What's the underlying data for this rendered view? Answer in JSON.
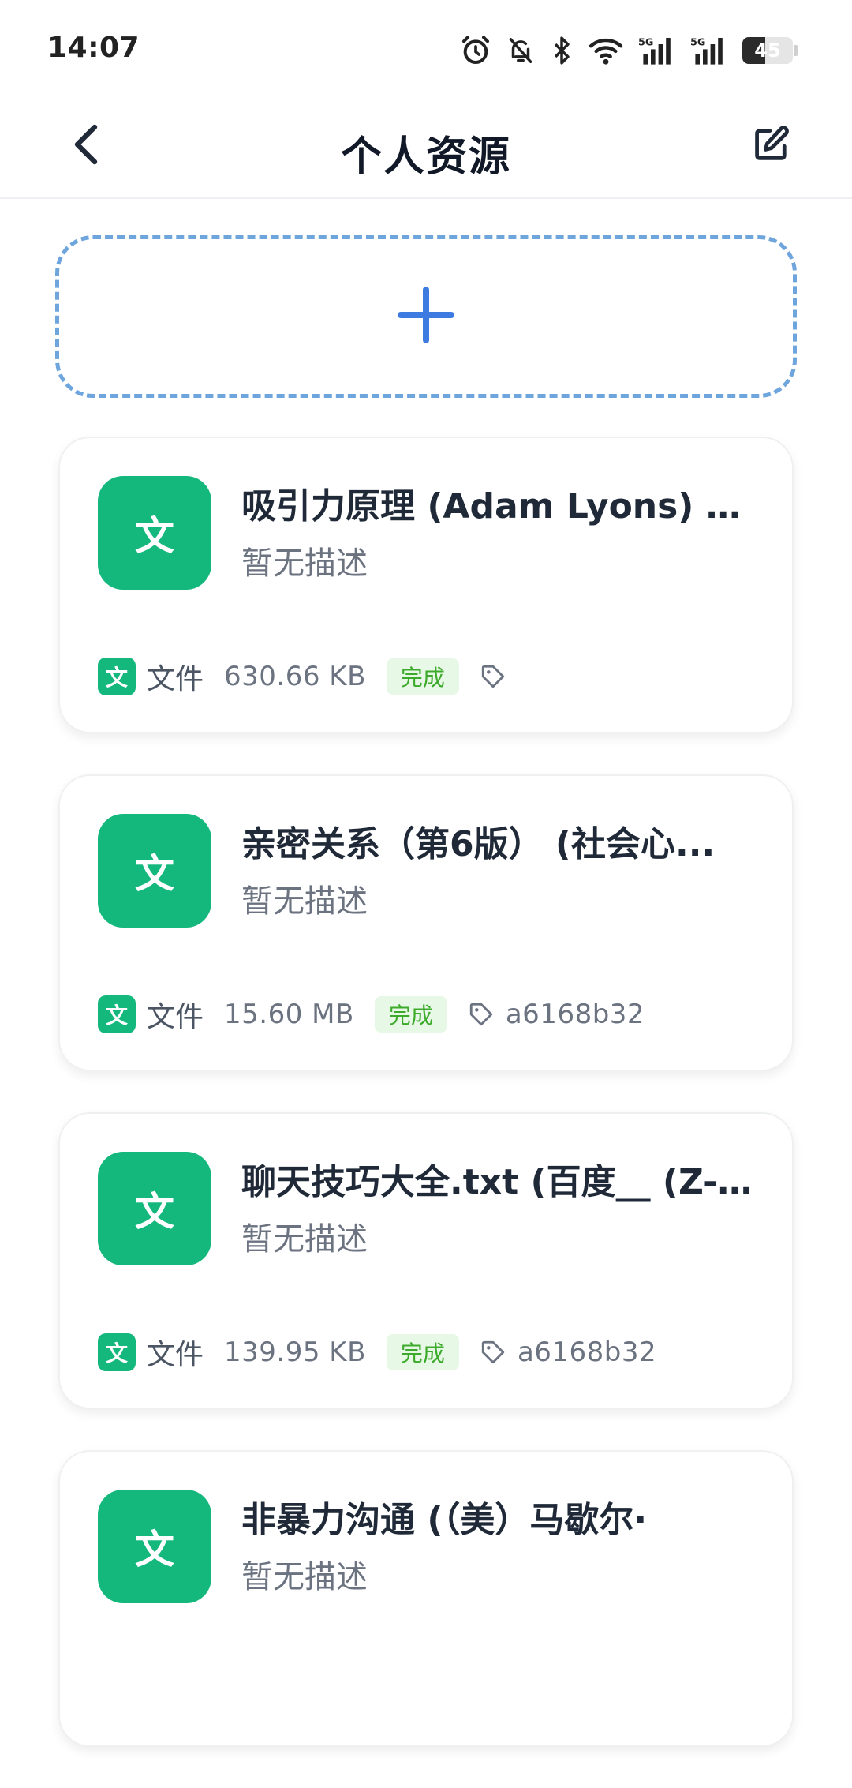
{
  "status_bar": {
    "time": "14:07",
    "battery_level": 45,
    "battery_text": "45",
    "icons": [
      "alarm-icon",
      "bell-muted-icon",
      "bluetooth-icon",
      "wifi-icon",
      "signal-5g-icon",
      "signal-5g-icon",
      "battery-icon"
    ]
  },
  "header": {
    "title": "个人资源",
    "back_icon": "chevron-left-icon",
    "edit_icon": "edit-icon"
  },
  "add_area": {
    "icon": "plus-icon",
    "color": "#6fa5dd"
  },
  "colors": {
    "accent_blue": "#3d7be0",
    "file_green": "#14b87d",
    "status_green": "#3caa2a"
  },
  "resources": [
    {
      "avatar": "文",
      "title": "吸引力原理 (Adam Lyons) (...",
      "description": "暂无描述",
      "type_icon": "文",
      "type_label": "文件",
      "size": "630.66 KB",
      "status": "完成",
      "tag": ""
    },
    {
      "avatar": "文",
      "title": "亲密关系（第6版） (社会心...",
      "description": "暂无描述",
      "type_icon": "文",
      "type_label": "文件",
      "size": "15.60 MB",
      "status": "完成",
      "tag": "a6168b32"
    },
    {
      "avatar": "文",
      "title": "聊天技巧大全.txt (百度__ (Z-...",
      "description": "暂无描述",
      "type_icon": "文",
      "type_label": "文件",
      "size": "139.95 KB",
      "status": "完成",
      "tag": "a6168b32"
    },
    {
      "avatar": "文",
      "title": "非暴力沟通 (（美）马歇尔·",
      "description": "暂无描述",
      "type_icon": "文",
      "type_label": "文件",
      "size": "",
      "status": "",
      "tag": ""
    }
  ]
}
